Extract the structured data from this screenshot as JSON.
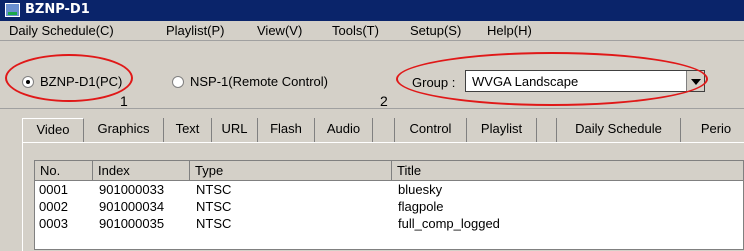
{
  "window": {
    "title": "BZNP-D1"
  },
  "menu": [
    "Daily Schedule(C)",
    "Playlist(P)",
    "View(V)",
    "Tools(T)",
    "Setup(S)",
    "Help(H)"
  ],
  "mode": {
    "option1": "BZNP-D1(PC)",
    "option2": "NSP-1(Remote Control)",
    "selected": "option1"
  },
  "group": {
    "label": "Group :",
    "value": "WVGA Landscape"
  },
  "annotations": {
    "marker1": "1",
    "marker2": "2",
    "color": "#e01818"
  },
  "tabs": [
    "Video",
    "Graphics",
    "Text",
    "URL",
    "Flash",
    "Audio",
    "",
    "Control",
    "Playlist",
    "",
    "Daily Schedule",
    "Perio"
  ],
  "table": {
    "headers": [
      "No.",
      "Index",
      "Type",
      "Title"
    ],
    "rows": [
      [
        "0001",
        "901000033",
        "NTSC",
        "bluesky"
      ],
      [
        "0002",
        "901000034",
        "NTSC",
        "flagpole"
      ],
      [
        "0003",
        "901000035",
        "NTSC",
        "full_comp_logged"
      ]
    ]
  }
}
